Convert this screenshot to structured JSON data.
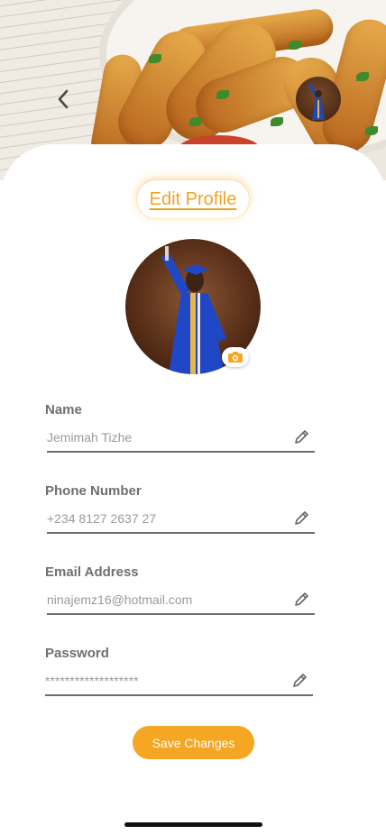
{
  "header": {
    "title": "Edit Profile",
    "back_icon": "chevron-left-icon",
    "avatar": "user-avatar"
  },
  "profile": {
    "photo": "profile-photo",
    "camera_icon": "camera-icon"
  },
  "fields": [
    {
      "label": "Name",
      "value": "Jemimah Tizhe"
    },
    {
      "label": "Phone Number",
      "value": "+234 8127 2637 27"
    },
    {
      "label": "Email Address",
      "value": "ninajemz16@hotmail.com"
    },
    {
      "label": "Password",
      "value": "*******************"
    }
  ],
  "actions": {
    "save_label": "Save Changes"
  },
  "colors": {
    "accent": "#f5a623",
    "title": "#f0a324",
    "label": "#6f6f6f",
    "value": "#9a9a9a"
  }
}
